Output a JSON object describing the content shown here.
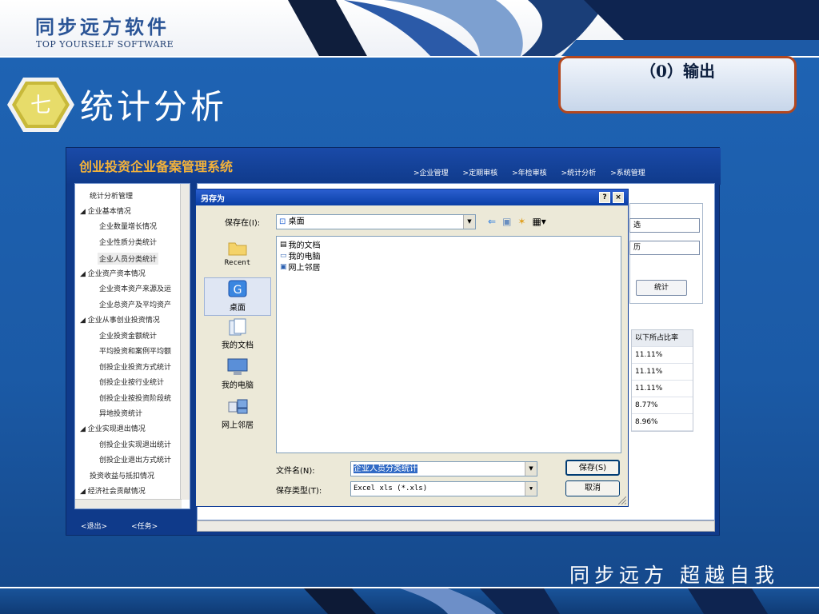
{
  "header": {
    "company_name": "同步远方软件",
    "company_en": "TOP YOURSELF SOFTWARE"
  },
  "section": {
    "number": "七",
    "title": "统计分析"
  },
  "callout": {
    "text": "（0）输出"
  },
  "slogan": "同步远方  超越自我",
  "app": {
    "title": "创业投资企业备案管理系统",
    "nav": [
      ">企业管理",
      ">定期审核",
      ">年检审核",
      ">统计分析",
      ">系统管理"
    ],
    "tree": [
      "统计分析管理",
      "◢ 企业基本情况",
      "企业数量增长情况",
      "企业性质分类统计",
      "企业人员分类统计",
      "◢ 企业资产资本情况",
      "企业资本资产来源及运",
      "企业总资产及平均资产",
      "◢ 企业从事创业投资情况",
      "企业投资金额统计",
      "平均投资和案例平均额",
      "创投企业投资方式统计",
      "创投企业按行业统计",
      "创投企业按投资阶段统",
      "异地投资统计",
      "◢ 企业实现退出情况",
      "创投企业实现退出统计",
      "创投企业退出方式统计",
      "投资收益与抵扣情况",
      "◢ 经济社会贡献情况"
    ],
    "exit_btn": "<退出>",
    "task_btn": "<任务>",
    "select1": "选",
    "select2": "历",
    "stats_btn": "统计",
    "table": {
      "header": "以下所占比率",
      "rows": [
        "11.11%",
        "11.11%",
        "11.11%",
        "8.77%",
        "8.96%"
      ]
    }
  },
  "dialog": {
    "title": "另存为",
    "help": "?",
    "close": "×",
    "save_in_label": "保存在(I):",
    "save_in_value": "桌面",
    "places": [
      "Recent",
      "桌面",
      "我的文档",
      "我的电脑",
      "网上邻居"
    ],
    "files": [
      "我的文档",
      "我的电脑",
      "网上邻居"
    ],
    "filename_label": "文件名(N):",
    "filename_value": "企业人员分类统计",
    "filetype_label": "保存类型(T):",
    "filetype_value": "Excel xls (*.xls)",
    "save_btn": "保存(S)",
    "cancel_btn": "取消"
  }
}
